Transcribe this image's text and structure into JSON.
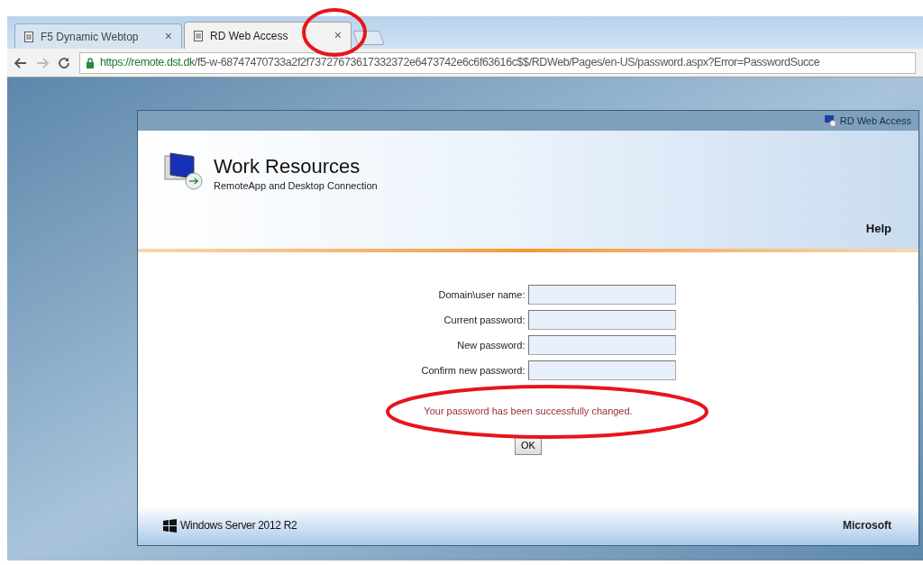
{
  "tabs": [
    {
      "title": "F5 Dynamic Webtop",
      "close": "×",
      "selected": false
    },
    {
      "title": "RD Web Access",
      "close": "×",
      "selected": true
    }
  ],
  "address_bar": {
    "url_host": "https://remote.dst.dk",
    "url_path": "/f5-w-68747470733a2f2f73727673617332372e6473742e6c6f63616c$$/RDWeb/Pages/en-US/password.aspx?Error=PasswordSucce"
  },
  "header": {
    "top_link": "RD Web Access",
    "title": "Work Resources",
    "subtitle": "RemoteApp and Desktop Connection",
    "help": "Help"
  },
  "form": {
    "fields": [
      {
        "label": "Domain\\user name:"
      },
      {
        "label": "Current password:"
      },
      {
        "label": "New password:"
      },
      {
        "label": "Confirm new password:"
      }
    ],
    "message": "Your password has been successfully changed.",
    "button": "OK"
  },
  "footer": {
    "product": "Windows Server 2012 R2",
    "brand": "Microsoft"
  }
}
